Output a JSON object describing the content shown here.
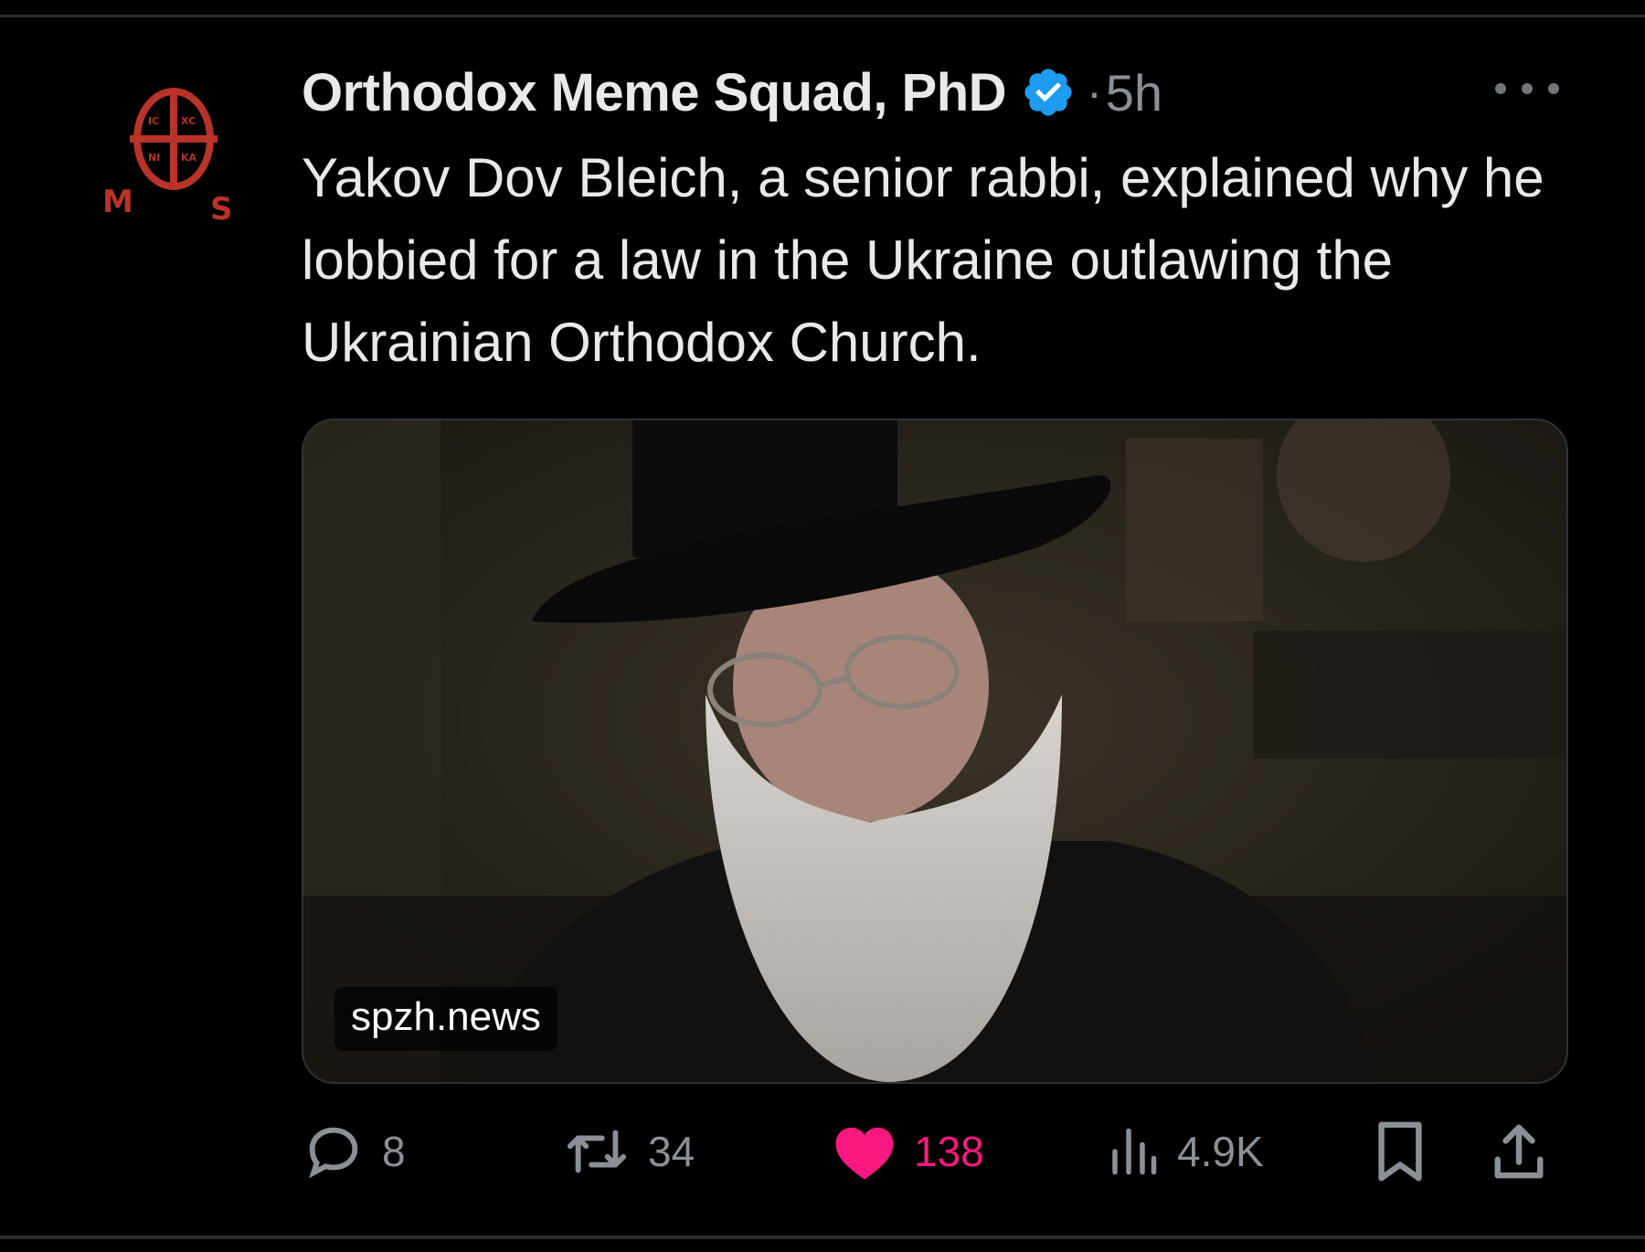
{
  "tweet": {
    "display_name": "Orthodox Meme Squad, PhD",
    "separator": "·",
    "time": "5h",
    "text": "Yakov Dov Bleich, a senior rabbi, explained why he lobbied for a law in the Ukraine outlawing the Ukrainian Orthodox Church.",
    "avatar_letters": {
      "left": "M",
      "right": "S",
      "cross_ic": "IC",
      "cross_xc": "XC",
      "cross_ni": "NI",
      "cross_ka": "KA"
    },
    "media": {
      "source_label": "spzh.news"
    },
    "actions": {
      "replies": "8",
      "reposts": "34",
      "likes": "138",
      "views": "4.9K"
    }
  },
  "colors": {
    "background": "#000000",
    "text": "#e7e9ea",
    "muted": "#8b9096",
    "verified": "#1d9bf0",
    "like": "#f91880",
    "avatar_red": "#c0392b"
  },
  "icons": {
    "verified": "verified-badge-icon",
    "more": "more-dots-icon",
    "reply": "reply-icon",
    "repost": "repost-icon",
    "like": "heart-icon",
    "views": "views-chart-icon",
    "bookmark": "bookmark-icon",
    "share": "share-icon"
  }
}
